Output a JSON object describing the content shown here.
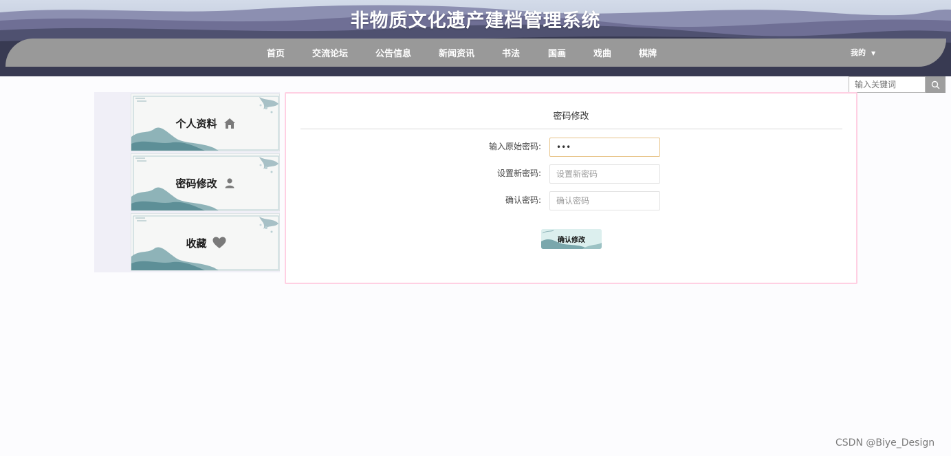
{
  "header": {
    "title": "非物质文化遗产建档管理系统"
  },
  "nav": {
    "items": [
      "首页",
      "交流论坛",
      "公告信息",
      "新闻资讯",
      "书法",
      "国画",
      "戏曲",
      "棋牌"
    ],
    "user_menu": "我的"
  },
  "search": {
    "placeholder": "输入关键词"
  },
  "sidebar": {
    "items": [
      {
        "label": "个人资料",
        "icon": "home-icon"
      },
      {
        "label": "密码修改",
        "icon": "user-icon"
      },
      {
        "label": "收藏",
        "icon": "heart-icon"
      }
    ]
  },
  "form": {
    "title": "密码修改",
    "old_password_label": "输入原始密码:",
    "old_password_value": "•••",
    "new_password_label": "设置新密码:",
    "new_password_placeholder": "设置新密码",
    "confirm_password_label": "确认密码:",
    "confirm_password_placeholder": "确认密码",
    "submit_label": "确认修改"
  },
  "watermark": "CSDN @Biye_Design",
  "colors": {
    "nav_bar": "#999999",
    "panel_border": "#ffd0e3",
    "active_input_border": "#e8c48a"
  }
}
